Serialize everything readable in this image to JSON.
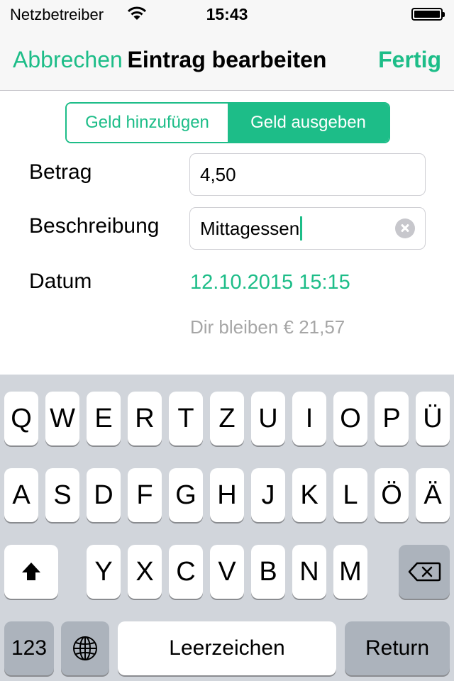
{
  "status_bar": {
    "carrier": "Netzbetreiber",
    "time": "15:43"
  },
  "nav": {
    "cancel": "Abbrechen",
    "title": "Eintrag bearbeiten",
    "done": "Fertig"
  },
  "segment": {
    "add": "Geld hinzufügen",
    "spend": "Geld ausgeben",
    "selected": "Geld ausgeben"
  },
  "form": {
    "amount_label": "Betrag",
    "amount_value": "4,50",
    "description_label": "Beschreibung",
    "description_value": "Mittagessen",
    "date_label": "Datum",
    "date_value": "12.10.2015 15:15",
    "remaining": "Dir bleiben € 21,57"
  },
  "keyboard": {
    "row1": [
      "Q",
      "W",
      "E",
      "R",
      "T",
      "Z",
      "U",
      "I",
      "O",
      "P",
      "Ü"
    ],
    "row2": [
      "A",
      "S",
      "D",
      "F",
      "G",
      "H",
      "J",
      "K",
      "L",
      "Ö",
      "Ä"
    ],
    "row3": [
      "Y",
      "X",
      "C",
      "V",
      "B",
      "N",
      "M"
    ],
    "numbers": "123",
    "space": "Leerzeichen",
    "return": "Return"
  },
  "colors": {
    "accent": "#1dbd88",
    "keyboard_bg": "#d1d5db",
    "hint": "#a6a6a6"
  },
  "icons": {
    "wifi": "wifi-icon",
    "battery": "battery-icon",
    "shift": "shift-icon",
    "backspace": "backspace-icon",
    "globe": "globe-icon",
    "clear": "clear-icon"
  }
}
